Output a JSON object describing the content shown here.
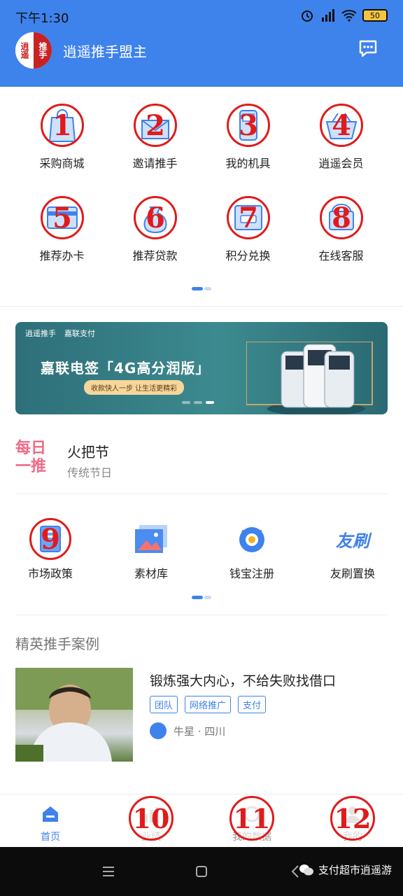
{
  "status_bar": {
    "time": "下午1:30",
    "battery": "50"
  },
  "header": {
    "title": "逍遥推手盟主",
    "avatar_text": [
      "逍遥",
      "推手"
    ]
  },
  "menu": {
    "items": [
      {
        "label": "采购商城",
        "badge": "1",
        "icon": "shopping-bag-icon"
      },
      {
        "label": "邀请推手",
        "badge": "2",
        "icon": "invite-icon"
      },
      {
        "label": "我的机具",
        "badge": "3",
        "icon": "pos-device-icon"
      },
      {
        "label": "逍遥会员",
        "badge": "4",
        "icon": "member-basket-icon"
      },
      {
        "label": "推荐办卡",
        "badge": "5",
        "icon": "card-icon"
      },
      {
        "label": "推荐贷款",
        "badge": "6",
        "icon": "money-bag-icon"
      },
      {
        "label": "积分兑换",
        "badge": "7",
        "icon": "points-icon"
      },
      {
        "label": "在线客服",
        "badge": "8",
        "icon": "customer-service-icon"
      }
    ]
  },
  "banner": {
    "brand_left": "逍遥推手",
    "brand_right": "嘉联支付",
    "title": "嘉联电签「4G高分润版」",
    "subtitle": "收款快人一步 让生活更精彩"
  },
  "daily": {
    "logo_top": "每日",
    "logo_bottom": "一推",
    "title": "火把节",
    "subtitle": "传统节日"
  },
  "tools": {
    "items": [
      {
        "label": "市场政策",
        "badge": "9",
        "icon": "policy-icon"
      },
      {
        "label": "素材库",
        "icon": "image-library-icon"
      },
      {
        "label": "钱宝注册",
        "icon": "qianbao-icon"
      },
      {
        "label": "友刷置换",
        "icon": "youshua-icon",
        "icon_text": "友刷"
      }
    ]
  },
  "cases": {
    "section_title": "精英推手案例",
    "items": [
      {
        "title": "锻炼强大内心，不给失败找借口",
        "tags": [
          "团队",
          "网络推广",
          "支付"
        ],
        "author": "牛星 · 四川"
      }
    ]
  },
  "tabbar": {
    "items": [
      {
        "label": "首页",
        "icon": "home-icon",
        "active": true
      },
      {
        "label": "业绩",
        "icon": "chart-icon",
        "badge": "10"
      },
      {
        "label": "我的数据",
        "icon": "data-icon",
        "badge": "11"
      },
      {
        "label": "我的",
        "icon": "user-icon",
        "badge": "12"
      }
    ]
  },
  "watermark": {
    "text": "支付超市逍遥游"
  },
  "colors": {
    "primary": "#3e82ec",
    "annotation_red": "#e01b1b",
    "daily_pink": "#f06a86"
  }
}
